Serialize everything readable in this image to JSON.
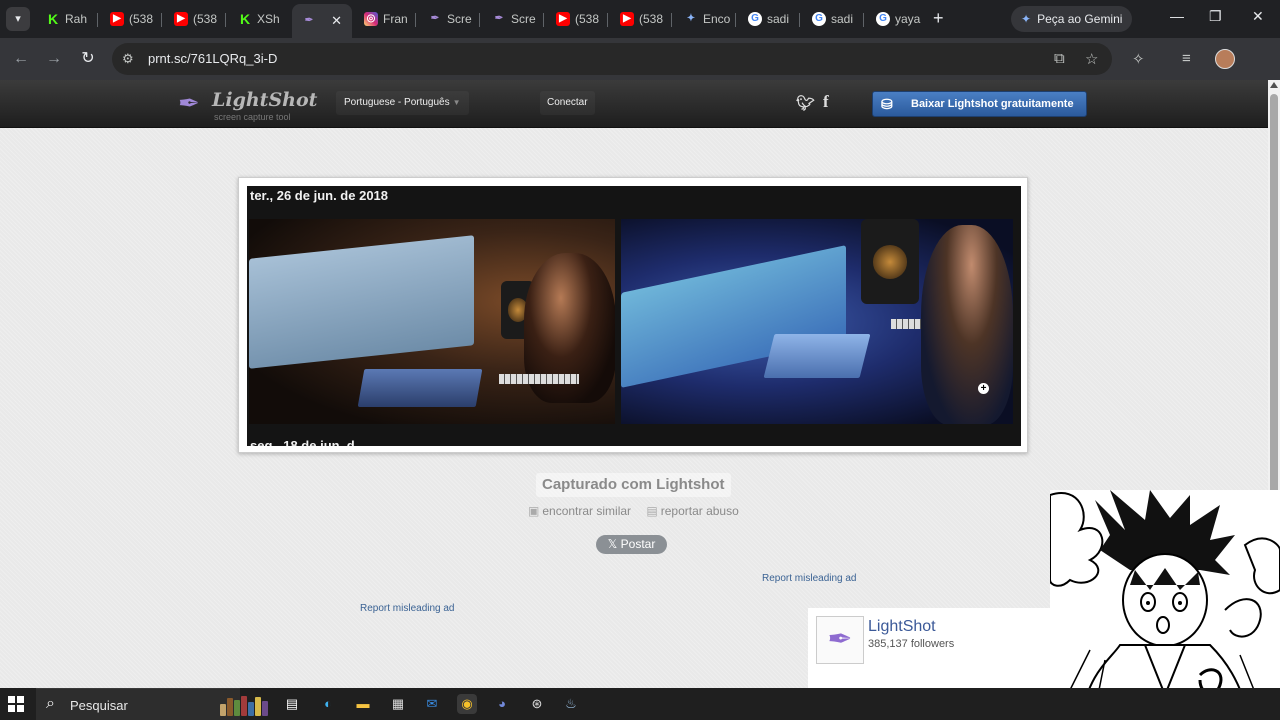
{
  "browser": {
    "tabs": [
      {
        "title": "Rah",
        "icon": "kick-icon",
        "active": false
      },
      {
        "title": "(538",
        "icon": "youtube-icon",
        "active": false
      },
      {
        "title": "(538",
        "icon": "youtube-icon",
        "active": false
      },
      {
        "title": "XSh",
        "icon": "kick-icon",
        "active": false
      },
      {
        "title": "",
        "icon": "lightshot-icon",
        "active": true
      },
      {
        "title": "Fran",
        "icon": "instagram-icon",
        "active": false
      },
      {
        "title": "Scre",
        "icon": "lightshot-icon",
        "active": false
      },
      {
        "title": "Scre",
        "icon": "lightshot-icon",
        "active": false
      },
      {
        "title": "(538",
        "icon": "youtube-icon",
        "active": false
      },
      {
        "title": "(538",
        "icon": "youtube-icon",
        "active": false
      },
      {
        "title": "Enco",
        "icon": "gemini-icon",
        "active": false
      },
      {
        "title": "sadi",
        "icon": "google-icon",
        "active": false
      },
      {
        "title": "sadi",
        "icon": "google-icon",
        "active": false
      },
      {
        "title": "yaya",
        "icon": "google-icon",
        "active": false
      }
    ],
    "gemini_button": "Peça ao Gemini",
    "url": "prnt.sc/761LQRq_3i-D"
  },
  "site": {
    "logo_name": "LightShot",
    "logo_tagline": "screen capture tool",
    "language": "Portuguese - Português",
    "login": "Conectar",
    "download_button": "Baixar Lightshot gratuitamente"
  },
  "screenshot": {
    "date_top": "ter., 26 de jun. de 2018",
    "date_bottom": "seg., 18 de jun. d"
  },
  "below_image": {
    "captured_with": "Capturado com Lightshot",
    "find_similar": "encontrar similar",
    "report_abuse": "reportar abuso",
    "post_button": "Postar",
    "ad_link_1": "Report misleading ad",
    "ad_link_2": "Report misleading ad"
  },
  "follow_card": {
    "name": "LightShot",
    "followers": "385,137 followers"
  },
  "taskbar": {
    "search_label": "Pesquisar"
  },
  "colors": {
    "download_button": "#2f62a8",
    "link": "#3b6394",
    "page_bg": "#e9e9e9"
  }
}
